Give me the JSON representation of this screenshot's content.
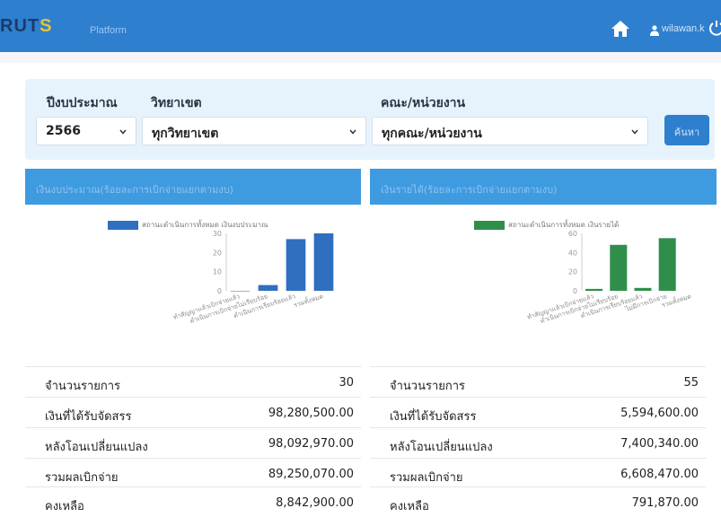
{
  "header": {
    "brand_main": "RUT",
    "brand_s": "S",
    "platform": "Platform",
    "username": "wilawan.k"
  },
  "filters": {
    "year_label": "ปีงบประมาณ",
    "year_value": "2566",
    "campus_label": "วิทยาเขต",
    "campus_value": "ทุกวิทยาเขต",
    "faculty_label": "คณะ/หน่วยงาน",
    "faculty_value": "ทุกคณะ/หน่วยงาน",
    "search_label": "ค้นหา"
  },
  "colors": {
    "topbar": "#2f7fcf",
    "left_series": "#2f6fc0",
    "right_series": "#2f8f4a"
  },
  "left_card": {
    "title": "เงินงบประมาณ(ร้อยละการเบิกจ่ายแยกตามงบ)",
    "stats": [
      {
        "label": "จำนวนรายการ",
        "value": "30"
      },
      {
        "label": "เงินที่ได้รับจัดสรร",
        "value": "98,280,500.00"
      },
      {
        "label": "หลังโอนเปลี่ยนแปลง",
        "value": "98,092,970.00"
      },
      {
        "label": "รวมผลเบิกจ่าย",
        "value": "89,250,070.00"
      },
      {
        "label": "คงเหลือ",
        "value": "8,842,900.00"
      }
    ]
  },
  "right_card": {
    "title": "เงินรายได้(ร้อยละการเบิกจ่ายแยกตามงบ)",
    "stats": [
      {
        "label": "จำนวนรายการ",
        "value": "55"
      },
      {
        "label": "เงินที่ได้รับจัดสรร",
        "value": "5,594,600.00"
      },
      {
        "label": "หลังโอนเปลี่ยนแปลง",
        "value": "7,400,340.00"
      },
      {
        "label": "รวมผลเบิกจ่าย",
        "value": "6,608,470.00"
      },
      {
        "label": "คงเหลือ",
        "value": "791,870.00"
      }
    ]
  },
  "chart_data": [
    {
      "type": "bar",
      "categories": [
        "ทำสัญญาแล้วเบิกจ่ายแล้ว",
        "ดำเนินการเบิกจ่ายไม่เรียบร้อย",
        "ดำเนินการเรียบร้อยแล้ว",
        "รวมทั้งหมด"
      ],
      "series": [
        {
          "name": "สถานะดำเนินการทั้งหมด เงินงบประมาณ",
          "values": [
            0,
            3,
            27,
            30
          ]
        }
      ],
      "yticks": [
        "0",
        "10",
        "20",
        "30"
      ],
      "ylim": [
        0,
        30
      ],
      "grid": false,
      "legend": "top"
    },
    {
      "type": "bar",
      "categories": [
        "ทำสัญญาแล้วเบิกจ่ายแล้ว",
        "ดำเนินการเบิกจ่ายไม่เรียบร้อย",
        "ดำเนินการเรียบร้อยแล้ว",
        "ไม่มีการเบิกจ่าย",
        "รวมทั้งหมด"
      ],
      "series": [
        {
          "name": "สถานะดำเนินการทั้งหมด เงินรายได้",
          "values": [
            2,
            48,
            3,
            55
          ]
        }
      ],
      "yticks": [
        "0",
        "20",
        "40",
        "60"
      ],
      "ylim": [
        0,
        60
      ],
      "grid": false,
      "legend": "top"
    }
  ]
}
